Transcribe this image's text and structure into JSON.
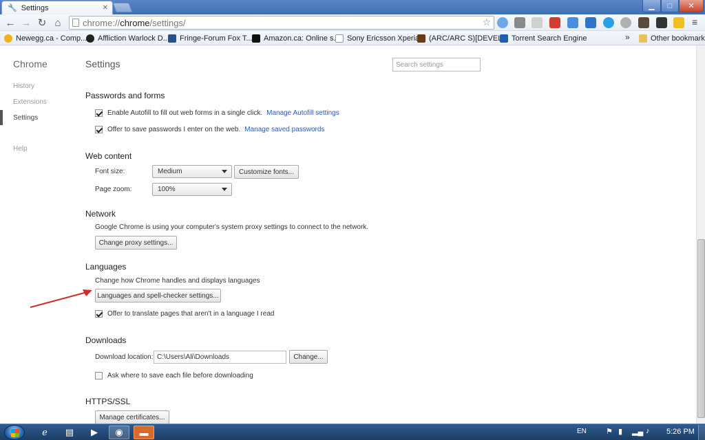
{
  "window": {
    "tab_title": "Settings",
    "tab_icon": "wrench-icon",
    "close_glyph": "✕",
    "controls": {
      "minimize": "▁",
      "maximize": "□",
      "close": "✕"
    }
  },
  "toolbar": {
    "back": "←",
    "forward": "→",
    "reload": "↻",
    "home": "⌂",
    "url_prefix": "chrome://",
    "url_host": "chrome",
    "url_path": "/settings/",
    "star": "☆",
    "menu": "≡"
  },
  "bookmarks": {
    "items": [
      {
        "label": "Newegg.ca - Comp...",
        "color": "#f2b01e"
      },
      {
        "label": "Affliction Warlock D...",
        "color": "#222222"
      },
      {
        "label": "Fringe-Forum Fox T...",
        "color": "#2b4f8a"
      },
      {
        "label": "Amazon.ca: Online s...",
        "color": "#111111"
      },
      {
        "label": "Sony Ericsson Xperia...",
        "color": "#ffffff"
      },
      {
        "label": "(ARC/ARC S)[DEVEL...",
        "color": "#6b3a12"
      },
      {
        "label": "Torrent Search Engine",
        "color": "#1d5fb0"
      }
    ],
    "overflow": "»",
    "other": "Other bookmarks"
  },
  "nav": {
    "title": "Chrome",
    "items": [
      "History",
      "Extensions",
      "Settings",
      "Help"
    ]
  },
  "settings": {
    "title": "Settings",
    "search_placeholder": "Search settings",
    "passwords": {
      "title": "Passwords and forms",
      "autofill_text": "Enable Autofill to fill out web forms in a single click.",
      "autofill_link": "Manage Autofill settings",
      "autofill_checked": true,
      "save_pw_text": "Offer to save passwords I enter on the web.",
      "save_pw_link": "Manage saved passwords",
      "save_pw_checked": true
    },
    "web_content": {
      "title": "Web content",
      "font_size_label": "Font size:",
      "font_size_value": "Medium",
      "customize_fonts": "Customize fonts...",
      "page_zoom_label": "Page zoom:",
      "page_zoom_value": "100%"
    },
    "network": {
      "title": "Network",
      "description": "Google Chrome is using your computer's system proxy settings to connect to the network.",
      "button": "Change proxy settings..."
    },
    "languages": {
      "title": "Languages",
      "description": "Change how Chrome handles and displays languages",
      "button": "Languages and spell-checker settings...",
      "translate_text": "Offer to translate pages that aren't in a language I read",
      "translate_checked": true
    },
    "downloads": {
      "title": "Downloads",
      "location_label": "Download location:",
      "location_value": "C:\\Users\\Ali\\Downloads",
      "change_button": "Change...",
      "ask_text": "Ask where to save each file before downloading",
      "ask_checked": false
    },
    "https": {
      "title": "HTTPS/SSL",
      "button": "Manage certificates..."
    }
  },
  "taskbar": {
    "lang": "EN",
    "time": "5:26 PM"
  },
  "colors": {
    "link": "#2a5db0",
    "arrow": "#d42a2a"
  }
}
